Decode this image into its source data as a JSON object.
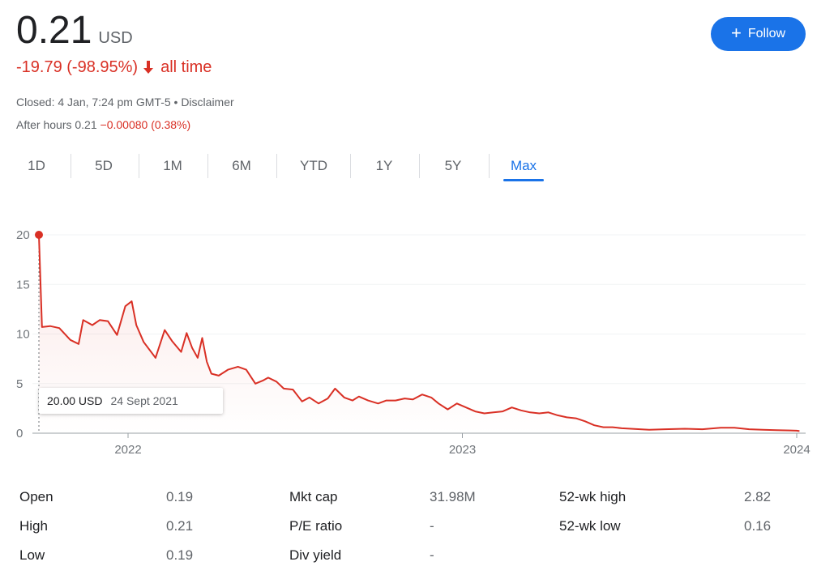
{
  "quote": {
    "price": "0.21",
    "currency": "USD",
    "change": "-19.79 (-98.95%)",
    "period": "all time",
    "closed_text": "Closed: 4 Jan, 7:24 pm GMT-5 • Disclaimer",
    "after_hours_label": "After hours 0.21",
    "after_hours_change": "−0.00080 (0.38%)"
  },
  "follow_button": {
    "label": "Follow"
  },
  "tabs": [
    {
      "label": "1D"
    },
    {
      "label": "5D"
    },
    {
      "label": "1M"
    },
    {
      "label": "6M"
    },
    {
      "label": "YTD"
    },
    {
      "label": "1Y"
    },
    {
      "label": "5Y"
    },
    {
      "label": "Max",
      "active": true
    }
  ],
  "tooltip": {
    "price": "20.00 USD",
    "date": "24 Sept 2021"
  },
  "chart_data": {
    "type": "line",
    "ylim": [
      0,
      20
    ],
    "y_ticks": [
      "0",
      "5",
      "10",
      "15",
      "20"
    ],
    "x_ticks": [
      "2022",
      "2023",
      "2024"
    ],
    "line_color": "#d93025",
    "grid": true,
    "series": [
      {
        "x": [
          "2021-09-24",
          "2021-09-29",
          "2021-10-08",
          "2021-10-18",
          "2021-10-30",
          "2021-11-08",
          "2021-11-13",
          "2021-11-23",
          "2021-12-01",
          "2021-12-10",
          "2021-12-20",
          "2021-12-29",
          "2022-01-05",
          "2022-01-10",
          "2022-01-18",
          "2022-01-31",
          "2022-02-10",
          "2022-02-18",
          "2022-02-28",
          "2022-03-06",
          "2022-03-12",
          "2022-03-18",
          "2022-03-23",
          "2022-03-28",
          "2022-04-02",
          "2022-04-10",
          "2022-04-20",
          "2022-05-01",
          "2022-05-10",
          "2022-05-20",
          "2022-05-28",
          "2022-06-03",
          "2022-06-12",
          "2022-06-20",
          "2022-06-30",
          "2022-07-10",
          "2022-07-18",
          "2022-07-28",
          "2022-08-07",
          "2022-08-15",
          "2022-08-25",
          "2022-09-03",
          "2022-09-10",
          "2022-09-20",
          "2022-10-01",
          "2022-10-10",
          "2022-10-20",
          "2022-10-30",
          "2022-11-08",
          "2022-11-18",
          "2022-11-28",
          "2022-12-06",
          "2022-12-16",
          "2022-12-26",
          "2023-01-05",
          "2023-01-15",
          "2023-01-25",
          "2023-02-04",
          "2023-02-14",
          "2023-02-24",
          "2023-03-06",
          "2023-03-16",
          "2023-03-26",
          "2023-04-05",
          "2023-04-15",
          "2023-04-25",
          "2023-05-05",
          "2023-05-15",
          "2023-05-25",
          "2023-06-04",
          "2023-06-14",
          "2023-06-24",
          "2023-07-04",
          "2023-07-14",
          "2023-07-24",
          "2023-08-10",
          "2023-09-01",
          "2023-09-20",
          "2023-10-10",
          "2023-10-25",
          "2023-11-10",
          "2023-11-25",
          "2023-12-10",
          "2023-12-25",
          "2024-01-01",
          "2024-01-04"
        ],
        "y": [
          20.0,
          10.7,
          10.8,
          10.6,
          9.4,
          9.0,
          11.4,
          10.9,
          11.4,
          11.3,
          9.9,
          12.8,
          13.3,
          10.9,
          9.2,
          7.6,
          10.4,
          9.3,
          8.2,
          10.1,
          8.6,
          7.6,
          9.6,
          7.2,
          6.0,
          5.8,
          6.4,
          6.7,
          6.4,
          5.0,
          5.3,
          5.6,
          5.2,
          4.5,
          4.4,
          3.2,
          3.6,
          3.0,
          3.5,
          4.5,
          3.6,
          3.3,
          3.7,
          3.3,
          3.0,
          3.3,
          3.3,
          3.5,
          3.4,
          3.9,
          3.6,
          3.0,
          2.4,
          3.0,
          2.6,
          2.2,
          2.0,
          2.1,
          2.2,
          2.6,
          2.3,
          2.1,
          2.0,
          2.1,
          1.8,
          1.6,
          1.5,
          1.2,
          0.8,
          0.6,
          0.6,
          0.5,
          0.45,
          0.4,
          0.35,
          0.4,
          0.45,
          0.4,
          0.55,
          0.55,
          0.4,
          0.35,
          0.3,
          0.28,
          0.25,
          0.21
        ]
      }
    ]
  },
  "stats": {
    "col1": [
      {
        "label": "Open",
        "value": "0.19"
      },
      {
        "label": "High",
        "value": "0.21"
      },
      {
        "label": "Low",
        "value": "0.19"
      }
    ],
    "col2": [
      {
        "label": "Mkt cap",
        "value": "31.98M"
      },
      {
        "label": "P/E ratio",
        "value": "-"
      },
      {
        "label": "Div yield",
        "value": "-"
      }
    ],
    "col3": [
      {
        "label": "52-wk high",
        "value": "2.82"
      },
      {
        "label": "52-wk low",
        "value": "0.16"
      }
    ]
  }
}
